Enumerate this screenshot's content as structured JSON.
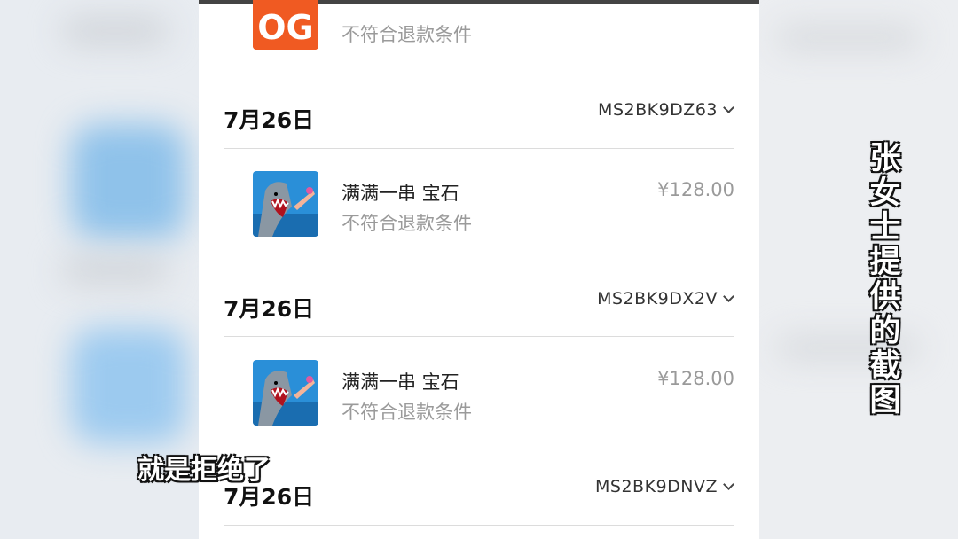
{
  "caption_vertical": "张女士提供的截图",
  "subtitle": "就是拒绝了",
  "purchases": {
    "top_partial": {
      "title": "",
      "status": "不符合退款条件",
      "price": "",
      "icon": "game-logo-icon",
      "icon_color": "#f05a22"
    },
    "groups": [
      {
        "date": "7月26日",
        "order_id": "MS2BK9DZ63",
        "item": {
          "title": "满满一串 宝石",
          "status": "不符合退款条件",
          "price": "¥128.00",
          "icon": "shark-game-icon"
        }
      },
      {
        "date": "7月26日",
        "order_id": "MS2BK9DX2V",
        "item": {
          "title": "满满一串 宝石",
          "status": "不符合退款条件",
          "price": "¥128.00",
          "icon": "shark-game-icon"
        }
      },
      {
        "date": "7月26日",
        "order_id": "MS2BK9DNVZ"
      }
    ]
  },
  "colors": {
    "accent_orange": "#f05a22",
    "muted_text": "#9a9a9a"
  }
}
